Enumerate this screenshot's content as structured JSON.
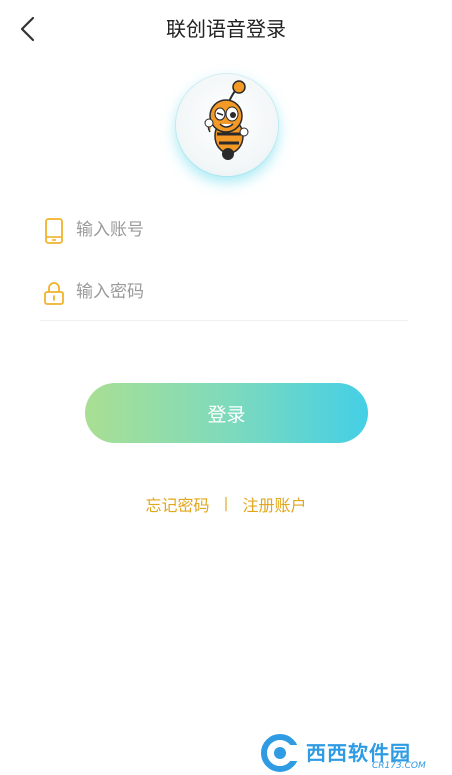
{
  "header": {
    "title": "联创语音登录",
    "back_icon": "chevron-left-icon"
  },
  "avatar": {
    "icon": "bee-mascot-icon"
  },
  "form": {
    "account_placeholder": "输入账号",
    "account_value": "",
    "account_icon": "phone-icon",
    "password_placeholder": "输入密码",
    "password_value": "",
    "password_icon": "lock-icon",
    "icon_color": "#f0b22a"
  },
  "login_button": {
    "label": "登录",
    "gradient_start": "#a9df93",
    "gradient_end": "#44cfe6"
  },
  "links": {
    "forgot_password": "忘记密码",
    "separator": "|",
    "register": "注册账户",
    "color": "#e0a71c"
  },
  "watermark": {
    "text": "西西软件园",
    "sub": "CR173.COM"
  }
}
